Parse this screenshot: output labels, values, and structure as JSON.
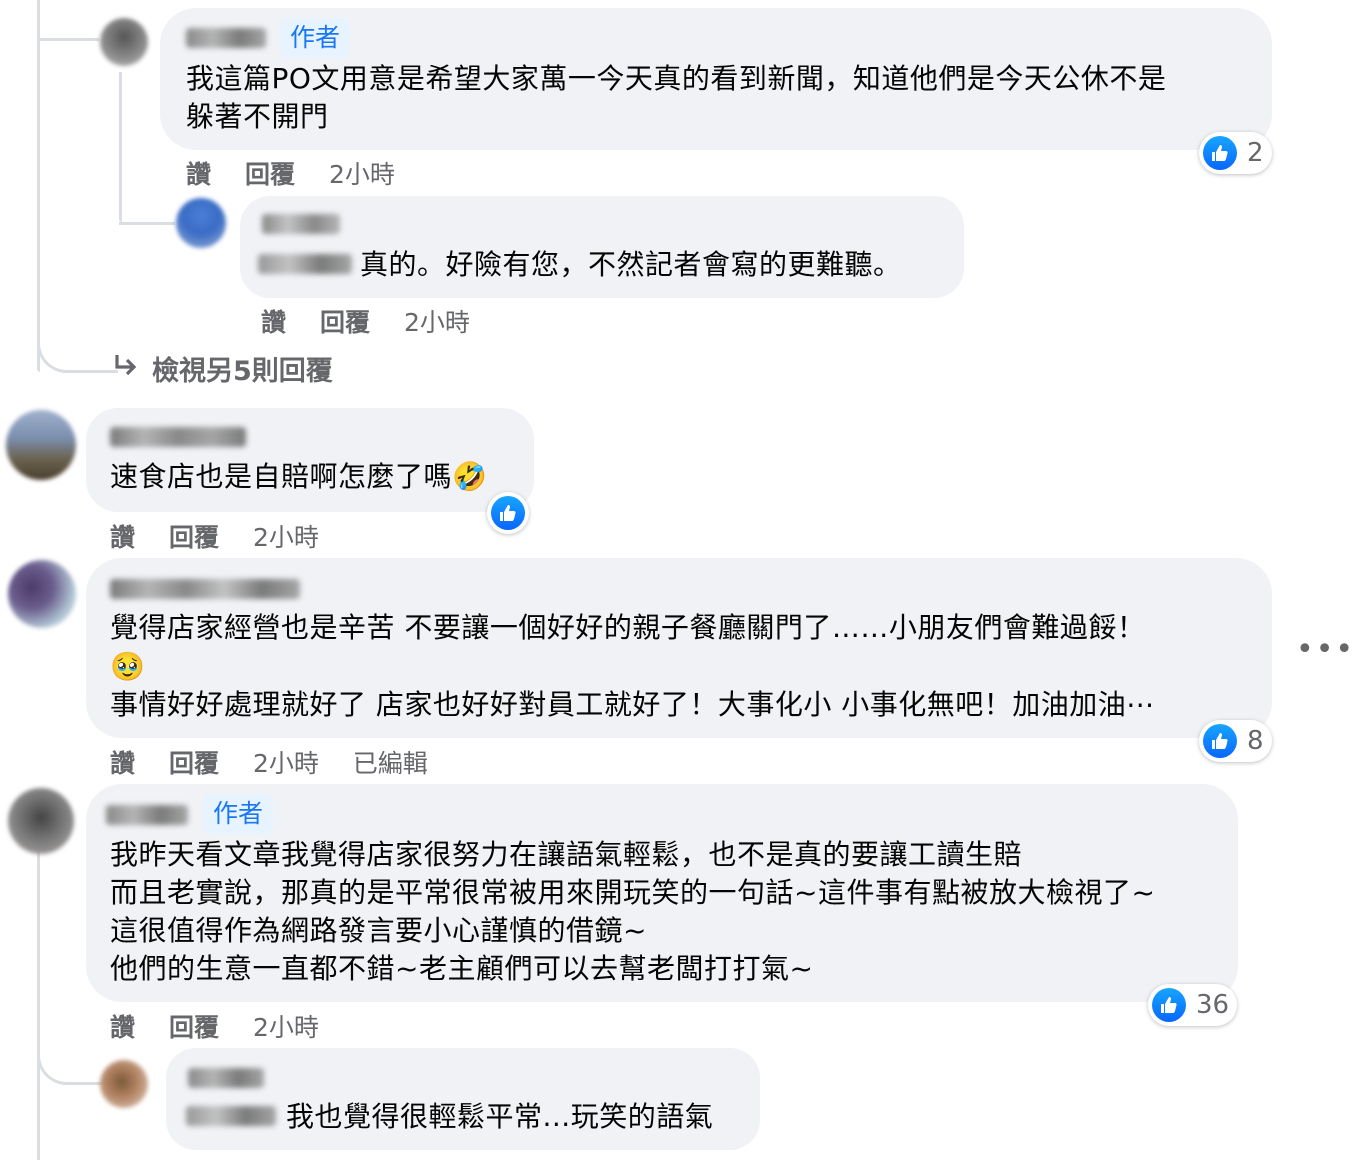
{
  "comments": [
    {
      "author_badge": "作者",
      "lines": [
        "我這篇PO文用意是希望大家萬一今天真的看到新聞，知道他們是今天公休不是",
        "躲著不開門"
      ],
      "actions": {
        "like": "讚",
        "reply": "回覆",
        "time": "2小時"
      },
      "reactions": "2"
    },
    {
      "text": "真的。好險有您，不然記者會寫的更難聽。",
      "actions": {
        "like": "讚",
        "reply": "回覆",
        "time": "2小時"
      }
    },
    {
      "text": "速食店也是自賠啊怎麼了嗎",
      "emoji": "🤣",
      "actions": {
        "like": "讚",
        "reply": "回覆",
        "time": "2小時"
      }
    },
    {
      "lines": [
        "覺得店家經營也是辛苦 不要讓一個好好的親子餐廳關門了……小朋友們會難過餒！",
        "事情好好處理就好了 店家也好好對員工就好了！大事化小 小事化無吧！加油加油⋯"
      ],
      "emoji": "🥹",
      "actions": {
        "like": "讚",
        "reply": "回覆",
        "time": "2小時",
        "edited": "已編輯"
      },
      "reactions": "8"
    },
    {
      "author_badge": "作者",
      "lines": [
        "我昨天看文章我覺得店家很努力在讓語氣輕鬆，也不是真的要讓工讀生賠",
        "而且老實說，那真的是平常很常被用來開玩笑的一句話~這件事有點被放大檢視了~",
        "這很值得作為網路發言要小心謹慎的借鏡~",
        "他們的生意一直都不錯~老主顧們可以去幫老闆打打氣~"
      ],
      "actions": {
        "like": "讚",
        "reply": "回覆",
        "time": "2小時"
      },
      "reactions": "36"
    },
    {
      "text": "我也覺得很輕鬆平常...玩笑的語氣"
    }
  ],
  "view_more_replies": "檢視另5則回覆",
  "more_options": "•••",
  "icons": {
    "like": "like-thumb-icon",
    "arrow": "reply-arrow-icon",
    "more": "more-options-icon"
  },
  "colors": {
    "bubble": "#f0f2f5",
    "accent": "#1877f2",
    "meta": "#65676b"
  }
}
